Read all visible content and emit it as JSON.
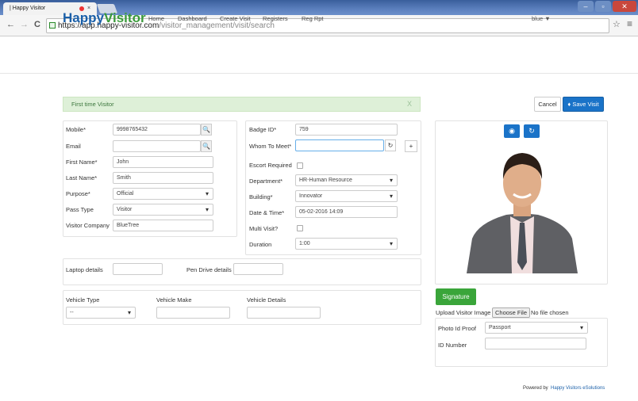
{
  "browser": {
    "tab_title": "| Happy Visitor",
    "tab_close": "×",
    "url_host": "https://app.happy-visitor.com",
    "url_path": "/visitor_management/visit/search",
    "back": "←",
    "forward": "→",
    "reload": "C",
    "menu": "≡",
    "star": "☆"
  },
  "nav": {
    "logo_a": "Happy",
    "logo_b": "Visitor",
    "links": [
      "Home",
      "Dashboard",
      "Create Visit",
      "Registers",
      "Reg Rpt"
    ],
    "user": "blue ▼"
  },
  "alert": {
    "text": "First time Visitor",
    "close": "X"
  },
  "actions": {
    "cancel": "Cancel",
    "save": "Save Visit"
  },
  "visitor": {
    "mobile_label": "Mobile*",
    "mobile": "9998765432",
    "email_label": "Email",
    "email": "",
    "first_label": "First Name*",
    "first": "John",
    "last_label": "Last Name*",
    "last": "Smith",
    "purpose_label": "Purpose*",
    "purpose": "Official",
    "pass_label": "Pass Type",
    "pass": "Visitor",
    "company_label": "Visitor Company",
    "company": "BlueTree"
  },
  "visit": {
    "badge_label": "Badge ID*",
    "badge": "759",
    "whom_label": "Whom To Meet*",
    "whom": "",
    "escort_label": "Escort Required",
    "dept_label": "Department*",
    "dept": "HR-Human Resource",
    "building_label": "Building*",
    "building": "Innovator",
    "date_label": "Date & Time*",
    "date": "05-02-2016 14:09",
    "multi_label": "Multi Visit?",
    "duration_label": "Duration",
    "duration": "1:00"
  },
  "devices": {
    "laptop_label": "Laptop details",
    "laptop": "",
    "pen_label": "Pen Drive details",
    "pen": ""
  },
  "vehicle": {
    "type_label": "Vehicle Type",
    "type": "--",
    "make_label": "Vehicle Make",
    "make": "",
    "details_label": "Vehicle Details",
    "details": ""
  },
  "media": {
    "signature": "Signature",
    "upload_label": "Upload Visitor Image",
    "choose": "Choose File",
    "nofile": "No file chosen",
    "photo_id_label": "Photo Id Proof",
    "photo_id": "Passport",
    "id_number_label": "ID Number",
    "id_number": ""
  },
  "footer": {
    "powered": "Powered by",
    "brand": "Happy Visitors eSolutions"
  },
  "colors": {
    "primary": "#1a73c8",
    "success": "#3aa53a",
    "alert_bg": "#def0d8"
  }
}
